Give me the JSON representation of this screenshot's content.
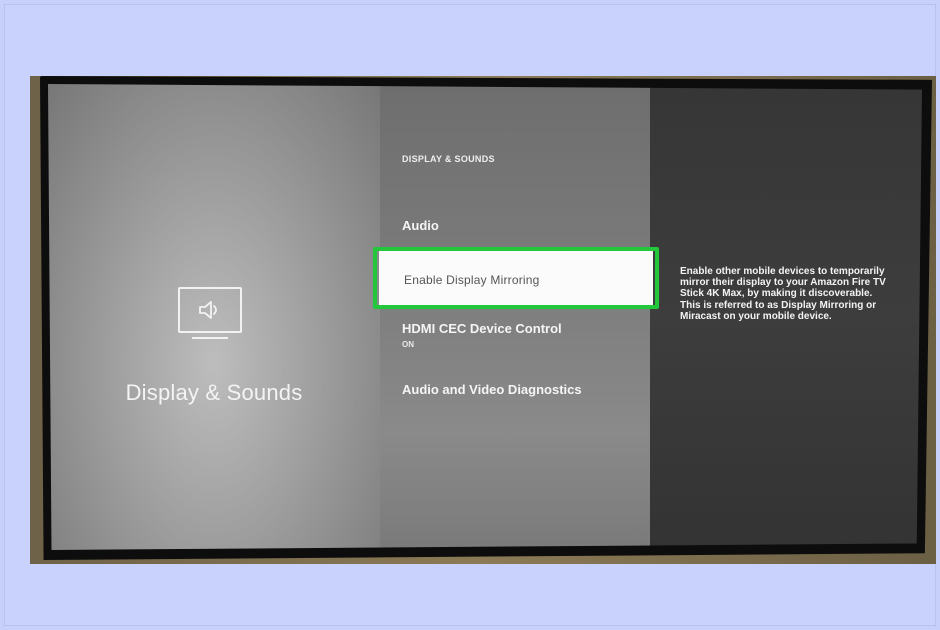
{
  "breadcrumb": "DISPLAY & SOUNDS",
  "section": {
    "title": "Display & Sounds",
    "icon": "tv-speaker-icon"
  },
  "menu": {
    "items": [
      {
        "label": "Audio",
        "sub": ""
      },
      {
        "label": "Enable Display Mirroring",
        "sub": ""
      },
      {
        "label": "HDMI CEC Device Control",
        "sub": "ON"
      },
      {
        "label": "Audio and Video Diagnostics",
        "sub": ""
      }
    ],
    "selected_index": 1
  },
  "description": "Enable other mobile devices to temporarily mirror their display to your Amazon Fire TV Stick 4K Max, by making it discoverable. This is referred to as Display Mirroring or Miracast on your mobile device.",
  "colors": {
    "highlight": "#22c73c",
    "selected_bg": "#fbfbfb",
    "page_bg": "#c7d0fb"
  }
}
